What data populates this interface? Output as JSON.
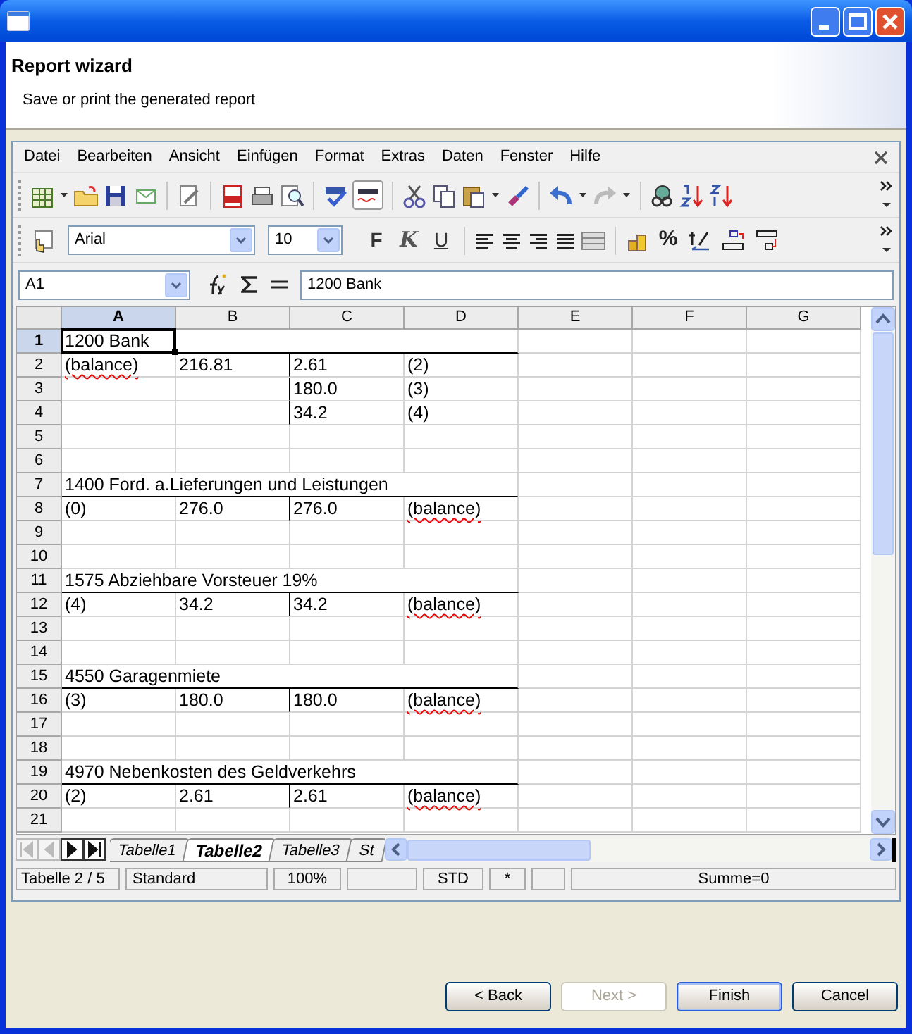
{
  "header": {
    "title": "Report wizard",
    "subtitle": "Save or print the generated report"
  },
  "menu": [
    "Datei",
    "Bearbeiten",
    "Ansicht",
    "Einfügen",
    "Format",
    "Extras",
    "Daten",
    "Fenster",
    "Hilfe"
  ],
  "format_toolbar": {
    "font": "Arial",
    "size": "10",
    "bold": "F",
    "italic": "K",
    "underline": "U",
    "percent": "%"
  },
  "formula_bar": {
    "cell": "A1",
    "content": "1200 Bank"
  },
  "columns": [
    {
      "label": "A",
      "selected": true
    },
    {
      "label": "B",
      "selected": false
    },
    {
      "label": "C",
      "selected": false
    },
    {
      "label": "D",
      "selected": false
    },
    {
      "label": "E",
      "selected": false
    },
    {
      "label": "F",
      "selected": false
    },
    {
      "label": "G",
      "selected": false
    }
  ],
  "rows": [
    {
      "label": "1",
      "kind": "title",
      "selected": true,
      "cells": {
        "A": {
          "text": "1200 Bank",
          "selected": true,
          "spell_error": false
        }
      }
    },
    {
      "label": "2",
      "kind": "entry",
      "selected": false,
      "cells": {
        "A": {
          "text": "(balance)",
          "selected": false,
          "spell_error": true
        },
        "B": {
          "text": "216.81",
          "selected": false,
          "spell_error": false
        },
        "C": {
          "text": "2.61",
          "selected": false,
          "spell_error": false
        },
        "D": {
          "text": "(2)",
          "selected": false,
          "spell_error": false
        }
      }
    },
    {
      "label": "3",
      "kind": "entry",
      "selected": false,
      "cells": {
        "C": {
          "text": "180.0",
          "selected": false,
          "spell_error": false
        },
        "D": {
          "text": "(3)",
          "selected": false,
          "spell_error": false
        }
      }
    },
    {
      "label": "4",
      "kind": "entry",
      "selected": false,
      "cells": {
        "C": {
          "text": "34.2",
          "selected": false,
          "spell_error": false
        },
        "D": {
          "text": "(4)",
          "selected": false,
          "spell_error": false
        }
      }
    },
    {
      "label": "5",
      "kind": "blank",
      "selected": false
    },
    {
      "label": "6",
      "kind": "blank",
      "selected": false
    },
    {
      "label": "7",
      "kind": "title",
      "selected": false,
      "cells": {
        "A": {
          "text": "1400 Ford. a.Lieferungen und Leistungen",
          "selected": false,
          "spell_error": false
        }
      }
    },
    {
      "label": "8",
      "kind": "entry",
      "selected": false,
      "cells": {
        "A": {
          "text": "(0)",
          "selected": false,
          "spell_error": false
        },
        "B": {
          "text": "276.0",
          "selected": false,
          "spell_error": false
        },
        "C": {
          "text": "276.0",
          "selected": false,
          "spell_error": false
        },
        "D": {
          "text": "(balance)",
          "selected": false,
          "spell_error": true
        }
      }
    },
    {
      "label": "9",
      "kind": "blank",
      "selected": false
    },
    {
      "label": "10",
      "kind": "blank",
      "selected": false
    },
    {
      "label": "11",
      "kind": "title",
      "selected": false,
      "cells": {
        "A": {
          "text": "1575 Abziehbare Vorsteuer 19%",
          "selected": false,
          "spell_error": false
        }
      }
    },
    {
      "label": "12",
      "kind": "entry",
      "selected": false,
      "cells": {
        "A": {
          "text": "(4)",
          "selected": false,
          "spell_error": false
        },
        "B": {
          "text": "34.2",
          "selected": false,
          "spell_error": false
        },
        "C": {
          "text": "34.2",
          "selected": false,
          "spell_error": false
        },
        "D": {
          "text": "(balance)",
          "selected": false,
          "spell_error": true
        }
      }
    },
    {
      "label": "13",
      "kind": "blank",
      "selected": false
    },
    {
      "label": "14",
      "kind": "blank",
      "selected": false
    },
    {
      "label": "15",
      "kind": "title",
      "selected": false,
      "cells": {
        "A": {
          "text": "4550 Garagenmiete",
          "selected": false,
          "spell_error": false
        }
      }
    },
    {
      "label": "16",
      "kind": "entry",
      "selected": false,
      "cells": {
        "A": {
          "text": "(3)",
          "selected": false,
          "spell_error": false
        },
        "B": {
          "text": "180.0",
          "selected": false,
          "spell_error": false
        },
        "C": {
          "text": "180.0",
          "selected": false,
          "spell_error": false
        },
        "D": {
          "text": "(balance)",
          "selected": false,
          "spell_error": true
        }
      }
    },
    {
      "label": "17",
      "kind": "blank",
      "selected": false
    },
    {
      "label": "18",
      "kind": "blank",
      "selected": false
    },
    {
      "label": "19",
      "kind": "title",
      "selected": false,
      "cells": {
        "A": {
          "text": "4970 Nebenkosten des Geldverkehrs",
          "selected": false,
          "spell_error": false
        }
      }
    },
    {
      "label": "20",
      "kind": "entry",
      "selected": false,
      "cells": {
        "A": {
          "text": "(2)",
          "selected": false,
          "spell_error": false
        },
        "B": {
          "text": "2.61",
          "selected": false,
          "spell_error": false
        },
        "C": {
          "text": "2.61",
          "selected": false,
          "spell_error": false
        },
        "D": {
          "text": "(balance)",
          "selected": false,
          "spell_error": true
        }
      }
    },
    {
      "label": "21",
      "kind": "blank",
      "selected": false
    }
  ],
  "sheet_tabs": [
    {
      "label": "Tabelle1",
      "selected": false
    },
    {
      "label": "Tabelle2",
      "selected": true
    },
    {
      "label": "Tabelle3",
      "selected": false
    },
    {
      "label": "St",
      "selected": false
    }
  ],
  "status_bar": [
    "Tabelle 2 / 5",
    "Standard",
    "100%",
    "STD",
    "*",
    "Summe=0"
  ],
  "buttons": [
    {
      "label": "< Back",
      "disabled": false,
      "default": false
    },
    {
      "label": "Next >",
      "disabled": true,
      "default": false
    },
    {
      "label": "Finish",
      "disabled": false,
      "default": true
    },
    {
      "label": "Cancel",
      "disabled": false,
      "default": false
    }
  ]
}
